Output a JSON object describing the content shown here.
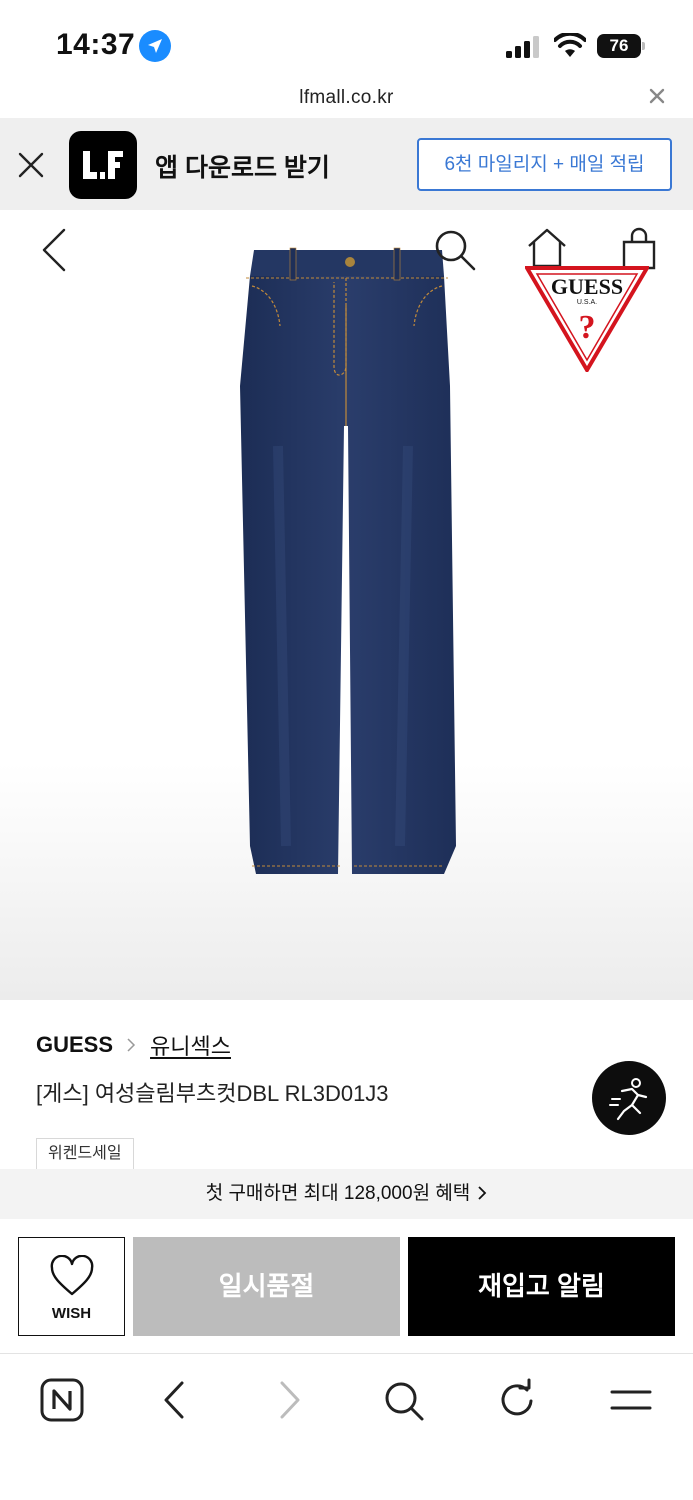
{
  "status_bar": {
    "time": "14:37",
    "battery": "76"
  },
  "browser": {
    "url": "lfmall.co.kr"
  },
  "app_banner": {
    "logo_text": "LF",
    "title": "앱 다운로드 받기",
    "cta": "6천 마일리지 + 매일 적립"
  },
  "product": {
    "brand": "GUESS",
    "category": "유니섹스",
    "name": "[게스] 여성슬림부츠컷DBL RL3D01J3",
    "tag": "위켄드세일",
    "logo_brand": "GUESS",
    "logo_sub": "U.S.A."
  },
  "benefit": {
    "text": "첫 구매하면 최대 128,000원 혜택"
  },
  "actions": {
    "wish_label": "WISH",
    "soldout_label": "일시품절",
    "restock_label": "재입고 알림"
  },
  "colors": {
    "accent_blue": "#3a78d4",
    "soldout_gray": "#bcbcbc",
    "black": "#000000",
    "logo_red": "#d4141e"
  }
}
